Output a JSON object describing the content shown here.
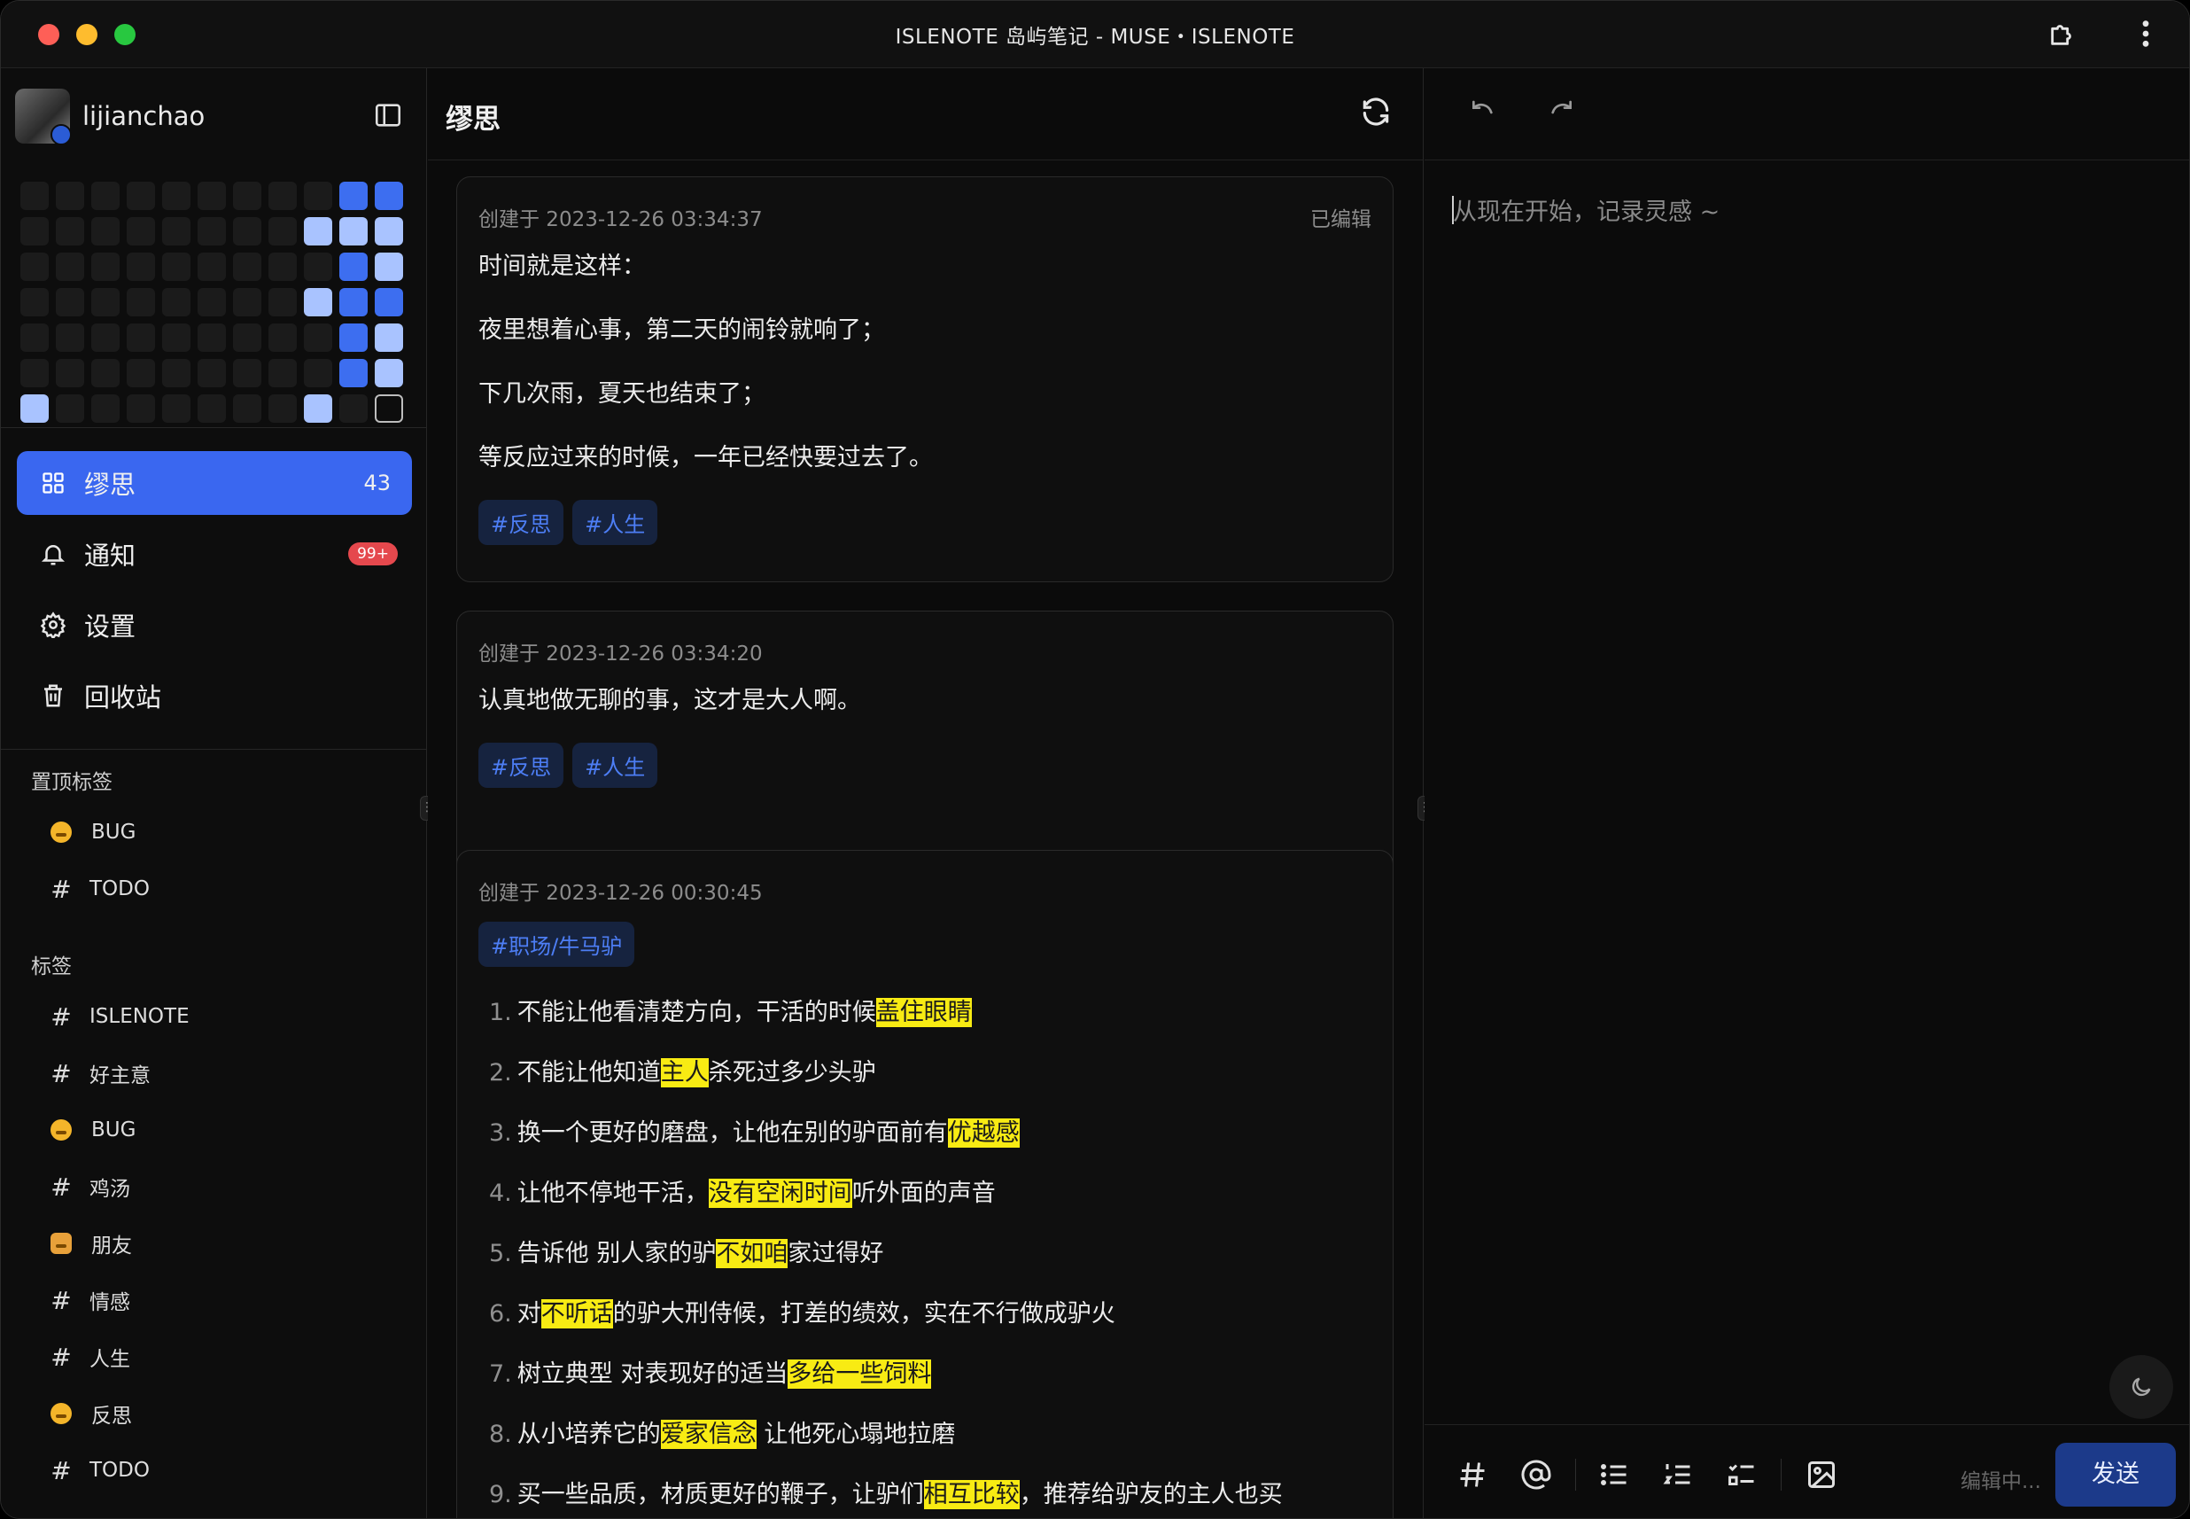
{
  "window": {
    "title": "ISLENOTE 岛屿笔记 - MUSE・ISLENOTE"
  },
  "user": {
    "name": "lijianchao"
  },
  "heatmap": {
    "levels": [
      [
        0,
        0,
        0,
        0,
        0,
        0,
        0,
        0,
        0,
        3,
        3
      ],
      [
        0,
        0,
        0,
        0,
        0,
        0,
        0,
        0,
        1,
        1,
        1
      ],
      [
        0,
        0,
        0,
        0,
        0,
        0,
        0,
        0,
        0,
        3,
        1
      ],
      [
        0,
        0,
        0,
        0,
        0,
        0,
        0,
        0,
        1,
        3,
        3
      ],
      [
        0,
        0,
        0,
        0,
        0,
        0,
        0,
        0,
        0,
        3,
        1
      ],
      [
        0,
        0,
        0,
        0,
        0,
        0,
        0,
        0,
        0,
        3,
        1
      ],
      [
        1,
        0,
        0,
        0,
        0,
        0,
        0,
        0,
        1,
        0,
        -1
      ]
    ]
  },
  "nav": {
    "items": [
      {
        "label": "缪思",
        "count": "43",
        "icon": "grid-icon",
        "active": true
      },
      {
        "label": "通知",
        "badge": "99+",
        "icon": "bell-icon"
      },
      {
        "label": "设置",
        "icon": "gear-icon"
      },
      {
        "label": "回收站",
        "icon": "trash-icon"
      }
    ]
  },
  "pinned": {
    "title": "置顶标签",
    "items": [
      {
        "label": "BUG",
        "icon": "emoji-face-icon"
      },
      {
        "label": "TODO",
        "icon": "hash-icon"
      }
    ]
  },
  "tags": {
    "title": "标签",
    "items": [
      {
        "label": "ISLENOTE",
        "icon": "hash-icon"
      },
      {
        "label": "好主意",
        "icon": "hash-icon"
      },
      {
        "label": "BUG",
        "icon": "emoji-face-icon"
      },
      {
        "label": "鸡汤",
        "icon": "hash-icon"
      },
      {
        "label": "朋友",
        "icon": "emoji-fist-icon"
      },
      {
        "label": "情感",
        "icon": "hash-icon"
      },
      {
        "label": "人生",
        "icon": "hash-icon"
      },
      {
        "label": "反思",
        "icon": "emoji-thinking-icon"
      },
      {
        "label": "TODO",
        "icon": "hash-icon"
      }
    ]
  },
  "main": {
    "title": "缪思",
    "cards": [
      {
        "created": "创建于 2023-12-26 03:34:37",
        "edited": "已编辑",
        "lines": [
          "时间就是这样：",
          "夜里想着心事，第二天的闹铃就响了；",
          "下几次雨，夏天也结束了；",
          "等反应过来的时候，一年已经快要过去了。"
        ],
        "tags": [
          "#反思",
          "#人生"
        ]
      },
      {
        "created": "创建于 2023-12-26 03:34:20",
        "lines": [
          "认真地做无聊的事，这才是大人啊。"
        ],
        "tags": [
          "#反思",
          "#人生"
        ]
      },
      {
        "created": "创建于 2023-12-26 00:30:45",
        "tags": [
          "#职场/牛马驴"
        ],
        "list": [
          {
            "n": "1.",
            "segments": [
              [
                "不能让他看清楚方向，干活的时候",
                false
              ],
              [
                "盖住眼睛",
                true
              ]
            ]
          },
          {
            "n": "2.",
            "segments": [
              [
                "不能让他知道",
                false
              ],
              [
                "主人",
                true
              ],
              [
                "杀死过多少头驴",
                false
              ]
            ]
          },
          {
            "n": "3.",
            "segments": [
              [
                "换一个更好的磨盘，让他在别的驴面前有",
                false
              ],
              [
                "优越感",
                true
              ]
            ]
          },
          {
            "n": "4.",
            "segments": [
              [
                "让他不停地干活，",
                false
              ],
              [
                "没有空闲时间",
                true
              ],
              [
                "听外面的声音",
                false
              ]
            ]
          },
          {
            "n": "5.",
            "segments": [
              [
                "告诉他 别人家的驴",
                false
              ],
              [
                "不如咱",
                true
              ],
              [
                "家过得好",
                false
              ]
            ]
          },
          {
            "n": "6.",
            "segments": [
              [
                "对",
                false
              ],
              [
                "不听话",
                true
              ],
              [
                "的驴大刑侍候，打差的绩效，实在不行做成驴火",
                false
              ]
            ]
          },
          {
            "n": "7.",
            "segments": [
              [
                "树立典型 对表现好的适当",
                false
              ],
              [
                "多给一些饲料",
                true
              ]
            ]
          },
          {
            "n": "8.",
            "segments": [
              [
                "从小培养它的",
                false
              ],
              [
                "爱家信念",
                true
              ],
              [
                " 让他死心塌地拉磨",
                false
              ]
            ]
          },
          {
            "n": "9.",
            "segments": [
              [
                "买一些品质，材质更好的鞭子，让驴们",
                false
              ],
              [
                "相互比较",
                true
              ],
              [
                "，推荐给驴友的主人也买",
                false
              ]
            ]
          }
        ]
      }
    ]
  },
  "editor": {
    "placeholder": "从现在开始，记录灵感 ~",
    "status": "编辑中...",
    "send_label": "发送"
  }
}
